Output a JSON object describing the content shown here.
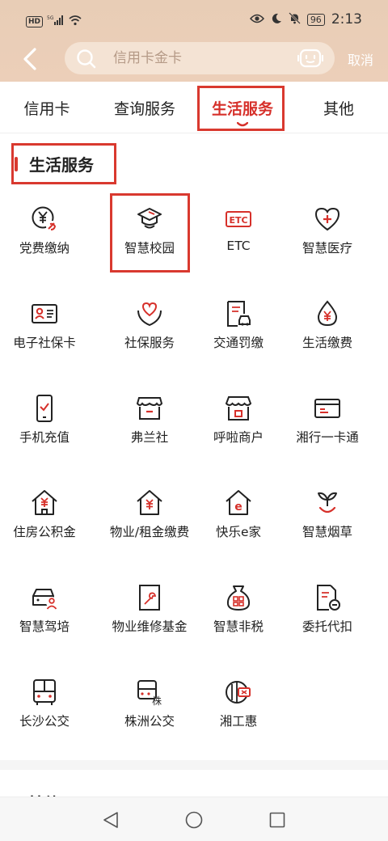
{
  "status_bar": {
    "left": [
      "HD",
      "5G"
    ],
    "battery": "96",
    "time": "2:13"
  },
  "header": {
    "search_placeholder": "信用卡金卡",
    "cancel_label": "取消"
  },
  "tabs": [
    {
      "label": "信用卡",
      "active": false
    },
    {
      "label": "查询服务",
      "active": false
    },
    {
      "label": "生活服务",
      "active": true
    },
    {
      "label": "其他",
      "active": false
    }
  ],
  "section": {
    "title": "生活服务",
    "next_title": "其他"
  },
  "services": [
    {
      "label": "党费缴纳",
      "icon": "party-fee-icon"
    },
    {
      "label": "智慧校园",
      "icon": "graduation-cap-icon"
    },
    {
      "label": "ETC",
      "icon": "etc-icon"
    },
    {
      "label": "智慧医疗",
      "icon": "medical-heart-icon"
    },
    {
      "label": "电子社保卡",
      "icon": "id-card-icon"
    },
    {
      "label": "社保服务",
      "icon": "heart-hands-icon"
    },
    {
      "label": "交通罚缴",
      "icon": "traffic-fine-icon"
    },
    {
      "label": "生活缴费",
      "icon": "drop-yen-icon"
    },
    {
      "label": "手机充值",
      "icon": "phone-check-icon"
    },
    {
      "label": "弗兰社",
      "icon": "store-icon"
    },
    {
      "label": "呼啦商户",
      "icon": "shop-awning-icon"
    },
    {
      "label": "湘行一卡通",
      "icon": "card-icon"
    },
    {
      "label": "住房公积金",
      "icon": "house-yen-icon"
    },
    {
      "label": "物业/租金缴费",
      "icon": "house-yen-icon"
    },
    {
      "label": "快乐e家",
      "icon": "house-e-icon"
    },
    {
      "label": "智慧烟草",
      "icon": "sprout-icon"
    },
    {
      "label": "智慧驾培",
      "icon": "car-person-icon"
    },
    {
      "label": "物业维修基金",
      "icon": "repair-doc-icon"
    },
    {
      "label": "智慧非税",
      "icon": "money-bag-icon"
    },
    {
      "label": "委托代扣",
      "icon": "doc-minus-icon"
    },
    {
      "label": "长沙公交",
      "icon": "bus-icon"
    },
    {
      "label": "株洲公交",
      "icon": "bus-card-icon",
      "badge": "株"
    },
    {
      "label": "湘工惠",
      "icon": "union-icon"
    }
  ],
  "colors": {
    "accent": "#d6302a",
    "header_bg": "#eccfb9",
    "highlight_box": "#d9392f"
  }
}
